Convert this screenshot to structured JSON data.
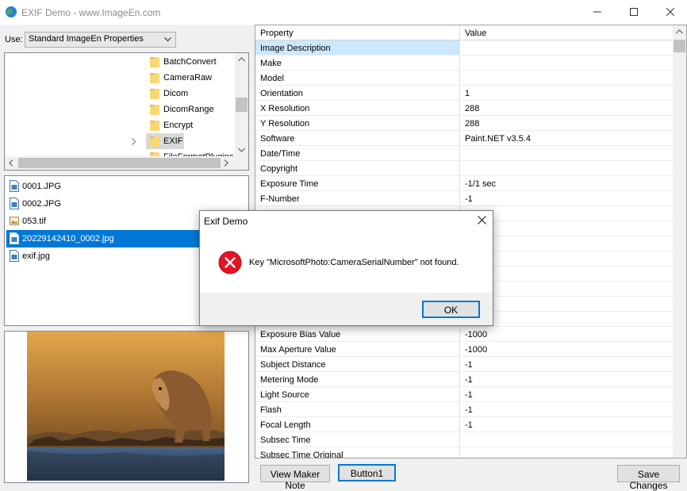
{
  "window": {
    "title": "EXIF Demo - www.ImageEn.com"
  },
  "use": {
    "label": "Use:",
    "selected": "Standard ImageEn Properties"
  },
  "folders": [
    "BatchConvert",
    "CameraRaw",
    "Dicom",
    "DicomRange",
    "Encrypt",
    "EXIF",
    "FileFormatPlugins"
  ],
  "files": [
    "0001.JPG",
    "0002.JPG",
    "053.tif",
    "20229142410_0002.jpg",
    "exif.jpg"
  ],
  "grid": {
    "header_property": "Property",
    "header_value": "Value",
    "rows": [
      {
        "p": "Image Description",
        "v": ""
      },
      {
        "p": "Make",
        "v": ""
      },
      {
        "p": "Model",
        "v": ""
      },
      {
        "p": "Orientation",
        "v": "1"
      },
      {
        "p": "X Resolution",
        "v": "288"
      },
      {
        "p": "Y Resolution",
        "v": "288"
      },
      {
        "p": "Software",
        "v": "Paint.NET v3.5.4"
      },
      {
        "p": "Date/Time",
        "v": ""
      },
      {
        "p": "Copyright",
        "v": ""
      },
      {
        "p": "Exposure Time",
        "v": "-1/1 sec"
      },
      {
        "p": "F-Number",
        "v": "-1"
      },
      {
        "p": "",
        "v": ""
      },
      {
        "p": "",
        "v": ""
      },
      {
        "p": "",
        "v": ""
      },
      {
        "p": "",
        "v": ""
      },
      {
        "p": "",
        "v": ""
      },
      {
        "p": "",
        "v": ""
      },
      {
        "p": "",
        "v": ""
      },
      {
        "p": "",
        "v": ""
      },
      {
        "p": "Exposure Bias Value",
        "v": "-1000"
      },
      {
        "p": "Max Aperture Value",
        "v": "-1000"
      },
      {
        "p": "Subject Distance",
        "v": "-1"
      },
      {
        "p": "Metering Mode",
        "v": "-1"
      },
      {
        "p": "Light Source",
        "v": "-1"
      },
      {
        "p": "Flash",
        "v": "-1"
      },
      {
        "p": "Focal Length",
        "v": "-1"
      },
      {
        "p": "Subsec Time",
        "v": ""
      },
      {
        "p": "Subsec Time Original",
        "v": ""
      }
    ]
  },
  "buttons": {
    "view_maker_note": "View Maker Note",
    "button1": "Button1",
    "save_changes": "Save Changes"
  },
  "dialog": {
    "title": "Exif Demo",
    "message": "Key \"MicrosoftPhoto:CameraSerialNumber\" not found.",
    "ok_label": "OK"
  },
  "colors": {
    "selection": "#0078d7",
    "grid_selection": "#cce8ff",
    "error_red": "#e81123"
  }
}
